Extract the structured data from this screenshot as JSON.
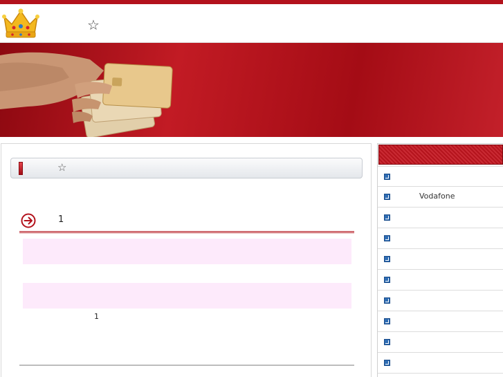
{
  "header": {
    "star_glyph": "☆"
  },
  "search": {
    "star_glyph": "☆"
  },
  "section": {
    "number": "1"
  },
  "content": {
    "small_number": "1"
  },
  "sidebar": {
    "items": [
      {
        "label": ""
      },
      {
        "label": "Vodafone"
      },
      {
        "label": ""
      },
      {
        "label": ""
      },
      {
        "label": ""
      },
      {
        "label": ""
      },
      {
        "label": ""
      },
      {
        "label": ""
      },
      {
        "label": ""
      },
      {
        "label": ""
      }
    ]
  },
  "colors": {
    "brand_red": "#b3121c",
    "pink_box": "#fdeafb",
    "bullet_blue": "#2f6db4"
  },
  "icons": {
    "logo": "crown-icon",
    "favorite": "star-icon",
    "section": "circle-arrow-right-icon",
    "bullet": "arrow-box-icon"
  }
}
